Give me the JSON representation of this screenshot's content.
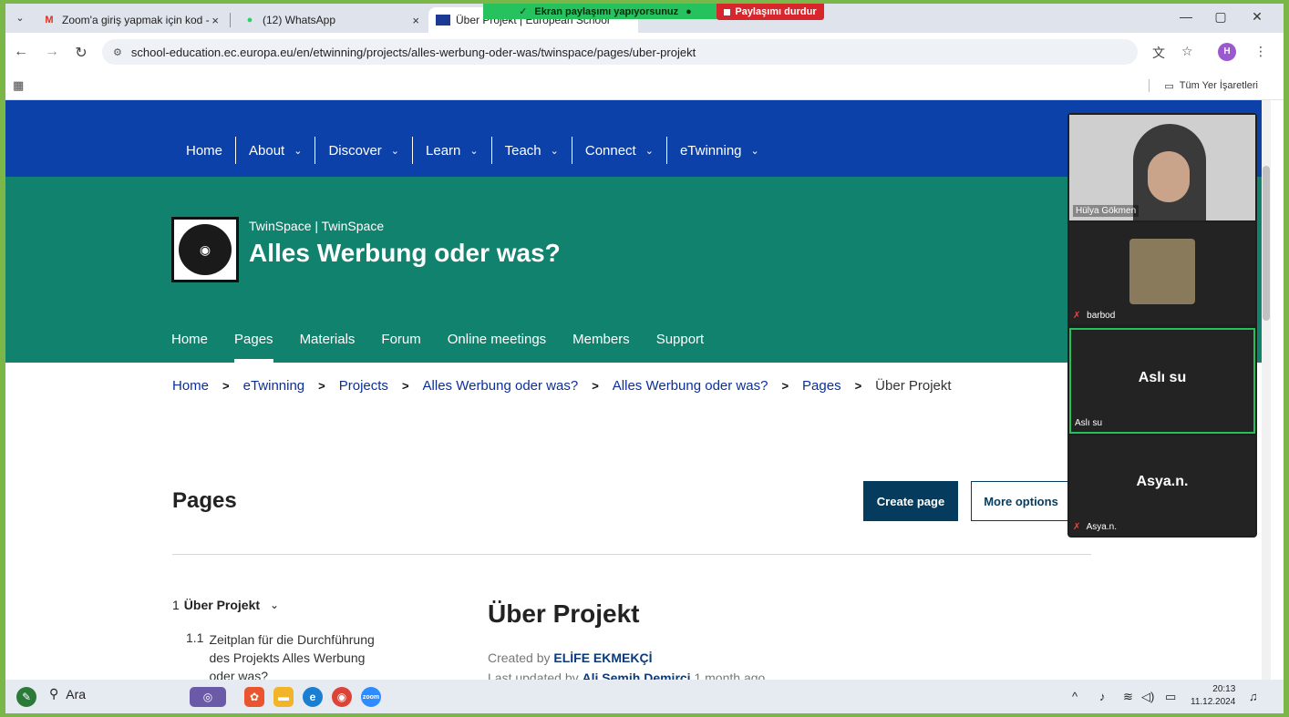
{
  "browser": {
    "tabs": [
      {
        "title": "Zoom'a giriş yapmak için kod -",
        "favicon": "M",
        "close": "×"
      },
      {
        "title": "(12) WhatsApp",
        "favicon": "●",
        "close": "×"
      },
      {
        "title": "Über Projekt | European School"
      }
    ],
    "window_controls": {
      "minimize": "—",
      "maximize": "▢",
      "close": "✕"
    },
    "url": "school-education.ec.europa.eu/en/etwinning/projects/alles-werbung-oder-was/twinspace/pages/uber-projekt",
    "profile_initial": "H",
    "bookmarks_all": "Tüm Yer İşaretleri"
  },
  "share": {
    "status": "Ekran paylaşımı yapıyorsunuz",
    "stop": "Paylaşımı durdur"
  },
  "site": {
    "topnav": [
      "Home",
      "About",
      "Discover",
      "Learn",
      "Teach",
      "Connect",
      "eTwinning"
    ],
    "hero": {
      "subtitle": "TwinSpace | TwinSpace",
      "title": "Alles Werbung oder was?",
      "tabs": [
        "Home",
        "Pages",
        "Materials",
        "Forum",
        "Online meetings",
        "Members",
        "Support"
      ]
    },
    "breadcrumb": [
      "Home",
      "eTwinning",
      "Projects",
      "Alles Werbung oder was?",
      "Alles Werbung oder was?",
      "Pages",
      "Über Projekt"
    ],
    "pages": {
      "title": "Pages",
      "create_button": "Create page",
      "more_button": "More options"
    },
    "toc": {
      "item1_num": "1",
      "item1_label": "Über Projekt",
      "item2_num": "1.1",
      "item2_label": "Zeitplan für die Durchführung des Projekts Alles Werbung oder was?"
    },
    "article": {
      "title": "Über Projekt",
      "created_prefix": "Created by",
      "created_by": "ELİFE EKMEKÇİ",
      "updated_prefix": "Last updated by",
      "updated_by": "Ali Semih Demirci",
      "updated_suffix": "1 month ago"
    }
  },
  "zoom": {
    "participants": [
      {
        "name": "Hülya Gökmen",
        "video": true
      },
      {
        "name": "barbod",
        "muted": true,
        "video": true
      },
      {
        "name": "Aslı su",
        "display": "Aslı su",
        "active": true
      },
      {
        "name": "Asya.n.",
        "display": "Asya.n.",
        "muted": true
      }
    ]
  },
  "taskbar": {
    "search": "Ara",
    "time": "20:13",
    "date": "11.12.2024"
  },
  "colors": {
    "topnav_bg": "#0b41a8",
    "hero_bg": "#10826d",
    "primary_button": "#053b5c",
    "share_green": "#25c25e",
    "share_red": "#d7262c"
  }
}
